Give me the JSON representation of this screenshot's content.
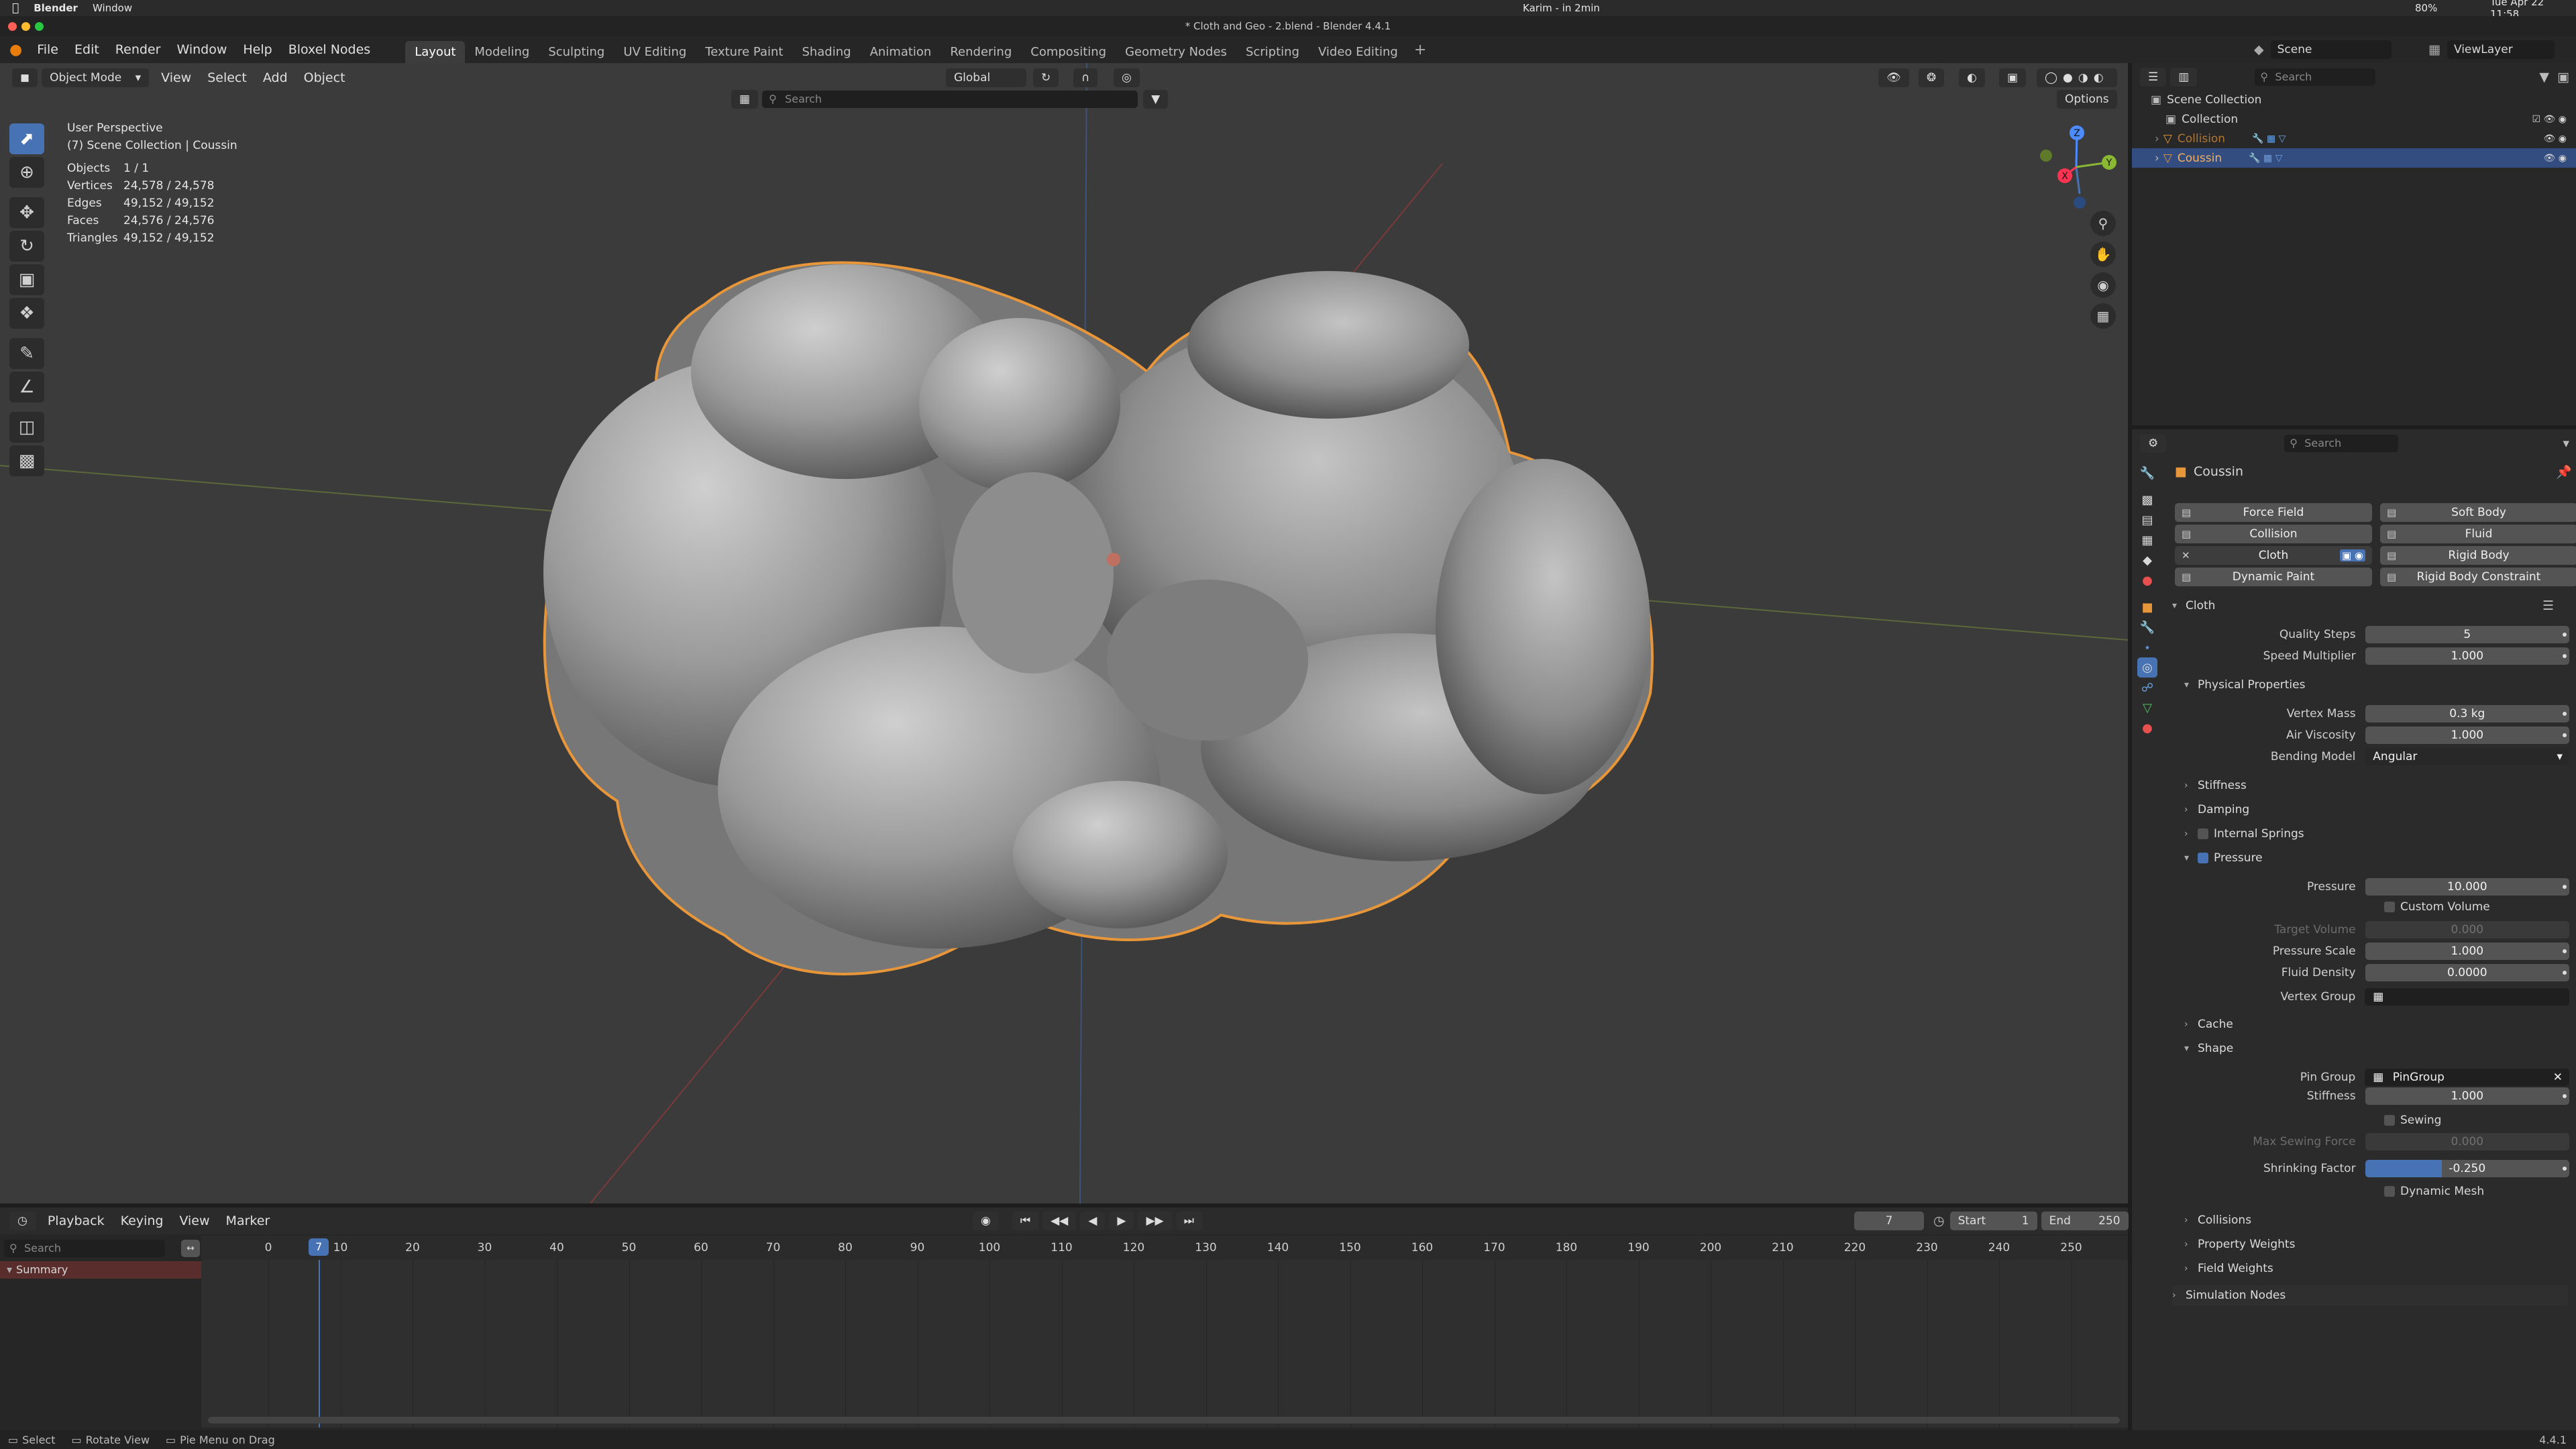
{
  "mac_menubar": {
    "app": "Blender",
    "menu": "Window",
    "right_status": "Karim - in 2min",
    "battery": "80%",
    "date": "Tue Apr 22 11:58"
  },
  "window_title": "* Cloth and Geo - 2.blend - Blender 4.4.1",
  "top_menu": [
    "File",
    "Edit",
    "Render",
    "Window",
    "Help",
    "Bloxel Nodes"
  ],
  "workspaces": [
    "Layout",
    "Modeling",
    "Sculpting",
    "UV Editing",
    "Texture Paint",
    "Shading",
    "Animation",
    "Rendering",
    "Compositing",
    "Geometry Nodes",
    "Scripting",
    "Video Editing"
  ],
  "active_workspace": "Layout",
  "scene_name": "Scene",
  "view_layer": "ViewLayer",
  "viewport": {
    "mode": "Object Mode",
    "menus": [
      "View",
      "Select",
      "Add",
      "Object"
    ],
    "transform_orientation": "Global",
    "search_placeholder": "Search",
    "options_label": "Options",
    "perspective": "User Perspective",
    "collection_info": "(7) Scene Collection | Coussin",
    "stats": [
      {
        "label": "Objects",
        "value": "1 / 1"
      },
      {
        "label": "Vertices",
        "value": "24,578 / 24,578"
      },
      {
        "label": "Edges",
        "value": "49,152 / 49,152"
      },
      {
        "label": "Faces",
        "value": "24,576 / 24,576"
      },
      {
        "label": "Triangles",
        "value": "49,152 / 49,152"
      }
    ],
    "gizmo": {
      "z": "Z",
      "y": "Y",
      "x": "X"
    }
  },
  "outliner": {
    "search_placeholder": "Search",
    "items": [
      {
        "label": "Scene Collection"
      },
      {
        "label": "Collection"
      },
      {
        "label": "Collision"
      },
      {
        "label": "Coussin"
      }
    ]
  },
  "properties": {
    "search_placeholder": "Search",
    "object_name": "Coussin",
    "physics_buttons": [
      [
        "Force Field",
        "Soft Body"
      ],
      [
        "Collision",
        "Fluid"
      ],
      [
        "Cloth",
        "Rigid Body"
      ],
      [
        "Dynamic Paint",
        "Rigid Body Constraint"
      ]
    ],
    "cloth_panel": "Cloth",
    "quality_steps": {
      "label": "Quality Steps",
      "value": "5"
    },
    "speed_multiplier": {
      "label": "Speed Multiplier",
      "value": "1.000"
    },
    "physical_properties": "Physical Properties",
    "vertex_mass": {
      "label": "Vertex Mass",
      "value": "0.3 kg"
    },
    "air_viscosity": {
      "label": "Air Viscosity",
      "value": "1.000"
    },
    "bending_model": {
      "label": "Bending Model",
      "value": "Angular"
    },
    "stiffness_panel": "Stiffness",
    "damping_panel": "Damping",
    "internal_springs_panel": "Internal Springs",
    "pressure_panel": "Pressure",
    "pressure": {
      "label": "Pressure",
      "value": "10.000"
    },
    "custom_volume": "Custom Volume",
    "target_volume": {
      "label": "Target Volume",
      "value": "0.000"
    },
    "pressure_scale": {
      "label": "Pressure Scale",
      "value": "1.000"
    },
    "fluid_density": {
      "label": "Fluid Density",
      "value": "0.0000"
    },
    "vertex_group": {
      "label": "Vertex Group",
      "value": ""
    },
    "cache_panel": "Cache",
    "shape_panel": "Shape",
    "pin_group": {
      "label": "Pin Group",
      "value": "PinGroup"
    },
    "shape_stiffness": {
      "label": "Stiffness",
      "value": "1.000"
    },
    "sewing": "Sewing",
    "max_sewing_force": {
      "label": "Max Sewing Force",
      "value": "0.000"
    },
    "shrinking_factor": {
      "label": "Shrinking Factor",
      "value": "-0.250",
      "fill_fraction": 0.375
    },
    "dynamic_mesh": "Dynamic Mesh",
    "collisions_panel": "Collisions",
    "property_weights_panel": "Property Weights",
    "field_weights_panel": "Field Weights",
    "simulation_nodes_panel": "Simulation Nodes"
  },
  "timeline": {
    "menus": [
      "Playback",
      "Keying",
      "View",
      "Marker"
    ],
    "current_frame": "7",
    "start_label": "Start",
    "start": "1",
    "end_label": "End",
    "end": "250",
    "search_placeholder": "Search",
    "summary": "Summary",
    "ticks": [
      "0",
      "10",
      "20",
      "30",
      "40",
      "50",
      "60",
      "70",
      "80",
      "90",
      "100",
      "110",
      "120",
      "130",
      "140",
      "150",
      "160",
      "170",
      "180",
      "190",
      "200",
      "210",
      "220",
      "230",
      "240",
      "250"
    ],
    "playhead": "7"
  },
  "statusbar": {
    "select": "Select",
    "rotate": "Rotate View",
    "pie": "Pie Menu on Drag",
    "version": "4.4.1"
  },
  "colors": {
    "accent": "#4772b3",
    "selection_outline": "#e8963a",
    "viewport_bg": "#3b3b3b"
  }
}
